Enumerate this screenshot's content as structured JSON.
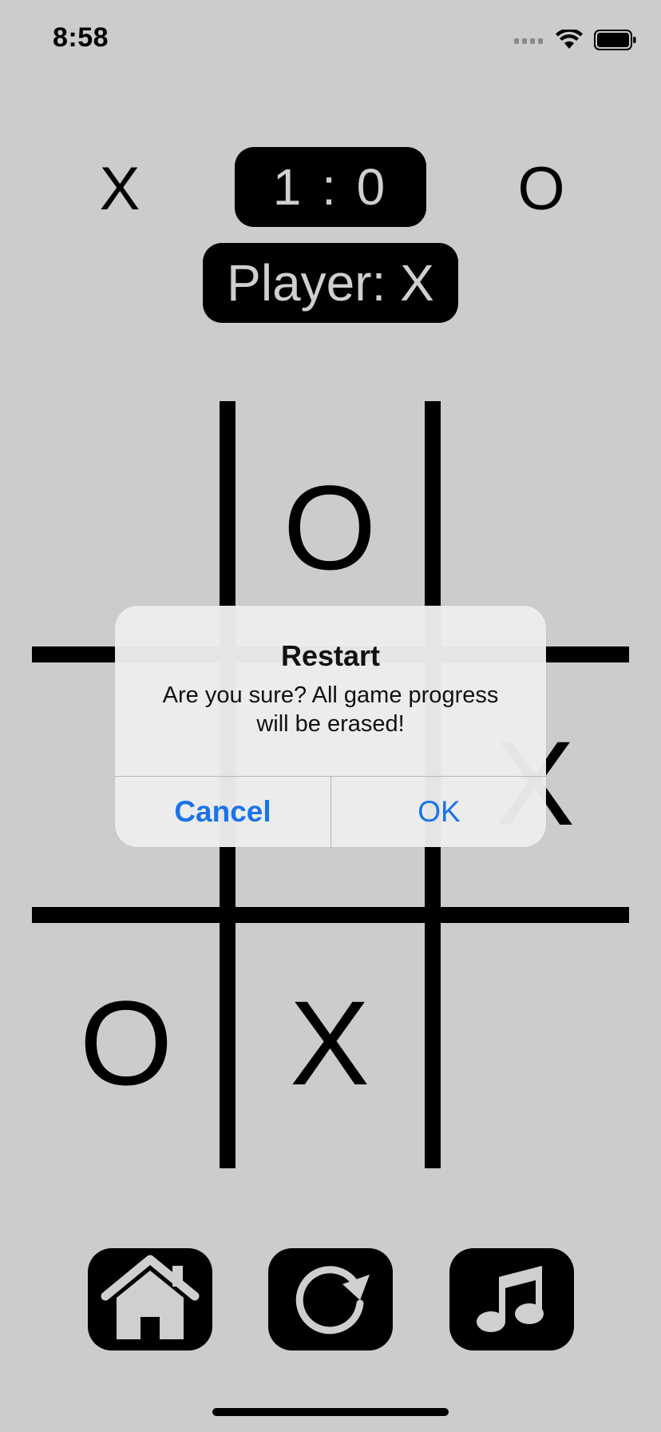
{
  "status_bar": {
    "time": "8:58",
    "icons": [
      "signal-icon",
      "wifi-icon",
      "battery-icon"
    ]
  },
  "scoreboard": {
    "player_x_label": "X",
    "player_o_label": "O",
    "score": "1 : 0",
    "current_player": "Player: X"
  },
  "board": {
    "cells": [
      "",
      "O",
      "",
      "",
      "",
      "X",
      "O",
      "X",
      ""
    ]
  },
  "alert": {
    "title": "Restart",
    "message": "Are you sure? All game progress will be erased!",
    "cancel_label": "Cancel",
    "ok_label": "OK"
  },
  "toolbar": {
    "items": [
      {
        "icon": "home-icon"
      },
      {
        "icon": "restart-icon"
      },
      {
        "icon": "music-icon"
      }
    ]
  },
  "colors": {
    "background": "#cccccc",
    "accent": "#1a73e8",
    "ink": "#000000"
  }
}
